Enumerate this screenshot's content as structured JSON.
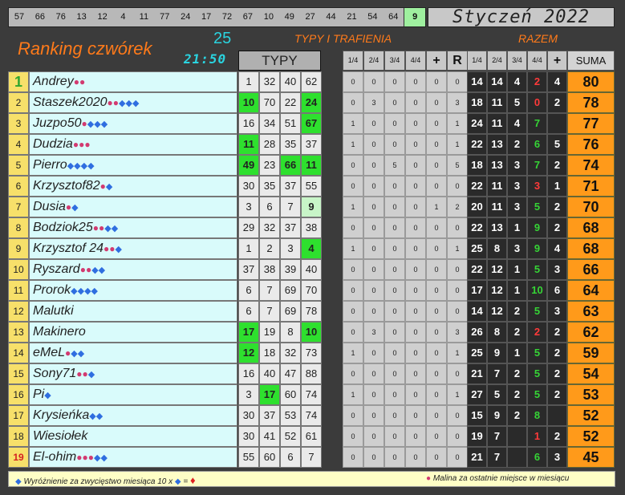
{
  "top_numbers": [
    "57",
    "66",
    "76",
    "13",
    "12",
    "4",
    "11",
    "77",
    "24",
    "17",
    "72",
    "67",
    "10",
    "49",
    "27",
    "44",
    "21",
    "54",
    "64",
    "9"
  ],
  "month": "Styczeń 2022",
  "title": "Ranking czwórek",
  "count": "25",
  "time": "21:50",
  "header_typy_trafienia": "TYPY I TRAFIENIA",
  "header_razem": "RAZEM",
  "typy_label": "TYPY",
  "sub_headers": [
    "1/4",
    "2/4",
    "3/4",
    "4/4",
    "+",
    "R"
  ],
  "razem_headers": [
    "1/4",
    "2/4",
    "3/4",
    "4/4",
    "+"
  ],
  "suma_label": "SUMA",
  "rows": [
    {
      "rank": "1",
      "name": "Andrey",
      "gems": 0,
      "rasp": 2,
      "typy": [
        "1",
        "32",
        "40",
        "62"
      ],
      "hits": [
        0,
        0,
        0,
        0
      ],
      "stats": [
        "0",
        "0",
        "0",
        "0",
        "0",
        "0"
      ],
      "razem": [
        "14",
        "14",
        "4",
        "2",
        "4"
      ],
      "suma": "80",
      "r3": "red"
    },
    {
      "rank": "2",
      "name": "Staszek2020",
      "gems": 3,
      "rasp": 2,
      "typy": [
        "10",
        "70",
        "22",
        "24"
      ],
      "hits": [
        1,
        0,
        0,
        1
      ],
      "stats": [
        "0",
        "3",
        "0",
        "0",
        "0",
        "3"
      ],
      "razem": [
        "18",
        "11",
        "5",
        "0",
        "2"
      ],
      "suma": "78",
      "r3": "red"
    },
    {
      "rank": "3",
      "name": "Juzpo50",
      "gems": 3,
      "rasp": 1,
      "typy": [
        "16",
        "34",
        "51",
        "67"
      ],
      "hits": [
        0,
        0,
        0,
        1
      ],
      "stats": [
        "1",
        "0",
        "0",
        "0",
        "0",
        "1"
      ],
      "razem": [
        "24",
        "11",
        "4",
        "7",
        ""
      ],
      "suma": "77",
      "r3": "green"
    },
    {
      "rank": "4",
      "name": "Dudzia",
      "gems": 0,
      "rasp": 3,
      "typy": [
        "11",
        "28",
        "35",
        "37"
      ],
      "hits": [
        1,
        0,
        0,
        0
      ],
      "stats": [
        "1",
        "0",
        "0",
        "0",
        "0",
        "1"
      ],
      "razem": [
        "22",
        "13",
        "2",
        "6",
        "5"
      ],
      "suma": "76",
      "r3": "green"
    },
    {
      "rank": "5",
      "name": "Pierro",
      "gems": 4,
      "rasp": 0,
      "typy": [
        "49",
        "23",
        "66",
        "11"
      ],
      "hits": [
        1,
        0,
        1,
        1
      ],
      "stats": [
        "0",
        "0",
        "5",
        "0",
        "0",
        "5"
      ],
      "razem": [
        "18",
        "13",
        "3",
        "7",
        "2"
      ],
      "suma": "74",
      "r3": "green"
    },
    {
      "rank": "6",
      "name": "Krzysztof82",
      "gems": 1,
      "rasp": 1,
      "typy": [
        "30",
        "35",
        "37",
        "55"
      ],
      "hits": [
        0,
        0,
        0,
        0
      ],
      "stats": [
        "0",
        "0",
        "0",
        "0",
        "0",
        "0"
      ],
      "razem": [
        "22",
        "11",
        "3",
        "3",
        "1"
      ],
      "suma": "71",
      "r3": "red"
    },
    {
      "rank": "7",
      "name": "Dusia",
      "gems": 1,
      "rasp": 1,
      "typy": [
        "3",
        "6",
        "7",
        "9"
      ],
      "hits": [
        0,
        0,
        0,
        2
      ],
      "stats": [
        "1",
        "0",
        "0",
        "0",
        "1",
        "2"
      ],
      "razem": [
        "20",
        "11",
        "3",
        "5",
        "2"
      ],
      "suma": "70",
      "r3": "green"
    },
    {
      "rank": "8",
      "name": "Bodziok25",
      "gems": 2,
      "rasp": 2,
      "typy": [
        "29",
        "32",
        "37",
        "38"
      ],
      "hits": [
        0,
        0,
        0,
        0
      ],
      "stats": [
        "0",
        "0",
        "0",
        "0",
        "0",
        "0"
      ],
      "razem": [
        "22",
        "13",
        "1",
        "9",
        "2"
      ],
      "suma": "68",
      "r3": "green"
    },
    {
      "rank": "9",
      "name": "Krzysztof 24",
      "gems": 1,
      "rasp": 2,
      "typy": [
        "1",
        "2",
        "3",
        "4"
      ],
      "hits": [
        0,
        0,
        0,
        1
      ],
      "stats": [
        "1",
        "0",
        "0",
        "0",
        "0",
        "1"
      ],
      "razem": [
        "25",
        "8",
        "3",
        "9",
        "4"
      ],
      "suma": "68",
      "r3": "green"
    },
    {
      "rank": "10",
      "name": "Ryszard",
      "gems": 2,
      "rasp": 2,
      "typy": [
        "37",
        "38",
        "39",
        "40"
      ],
      "hits": [
        0,
        0,
        0,
        0
      ],
      "stats": [
        "0",
        "0",
        "0",
        "0",
        "0",
        "0"
      ],
      "razem": [
        "22",
        "12",
        "1",
        "5",
        "3"
      ],
      "suma": "66",
      "r3": "green"
    },
    {
      "rank": "11",
      "name": "Prorok",
      "gems": 4,
      "rasp": 0,
      "typy": [
        "6",
        "7",
        "69",
        "70"
      ],
      "hits": [
        0,
        0,
        0,
        0
      ],
      "stats": [
        "0",
        "0",
        "0",
        "0",
        "0",
        "0"
      ],
      "razem": [
        "17",
        "12",
        "1",
        "10",
        "6"
      ],
      "suma": "64",
      "r3": "green"
    },
    {
      "rank": "12",
      "name": "Malutki",
      "gems": 0,
      "rasp": 0,
      "typy": [
        "6",
        "7",
        "69",
        "78"
      ],
      "hits": [
        0,
        0,
        0,
        0
      ],
      "stats": [
        "0",
        "0",
        "0",
        "0",
        "0",
        "0"
      ],
      "razem": [
        "14",
        "12",
        "2",
        "5",
        "3"
      ],
      "suma": "63",
      "r3": "green"
    },
    {
      "rank": "13",
      "name": "Makinero",
      "gems": 0,
      "rasp": 0,
      "typy": [
        "17",
        "19",
        "8",
        "10"
      ],
      "hits": [
        1,
        0,
        0,
        1
      ],
      "stats": [
        "0",
        "3",
        "0",
        "0",
        "0",
        "3"
      ],
      "razem": [
        "26",
        "8",
        "2",
        "2",
        "2"
      ],
      "suma": "62",
      "r3": "red"
    },
    {
      "rank": "14",
      "name": "eMeL",
      "gems": 2,
      "rasp": 1,
      "typy": [
        "12",
        "18",
        "32",
        "73"
      ],
      "hits": [
        1,
        0,
        0,
        0
      ],
      "stats": [
        "1",
        "0",
        "0",
        "0",
        "0",
        "1"
      ],
      "razem": [
        "25",
        "9",
        "1",
        "5",
        "2"
      ],
      "suma": "59",
      "r3": "green"
    },
    {
      "rank": "15",
      "name": "Sony71",
      "gems": 1,
      "rasp": 2,
      "typy": [
        "16",
        "40",
        "47",
        "88"
      ],
      "hits": [
        0,
        0,
        0,
        0
      ],
      "stats": [
        "0",
        "0",
        "0",
        "0",
        "0",
        "0"
      ],
      "razem": [
        "21",
        "7",
        "2",
        "5",
        "2"
      ],
      "suma": "54",
      "r3": "green"
    },
    {
      "rank": "16",
      "name": "Pi",
      "gems": 1,
      "rasp": 0,
      "typy": [
        "3",
        "17",
        "60",
        "74"
      ],
      "hits": [
        0,
        1,
        0,
        0
      ],
      "stats": [
        "1",
        "0",
        "0",
        "0",
        "0",
        "1"
      ],
      "razem": [
        "27",
        "5",
        "2",
        "5",
        "2"
      ],
      "suma": "53",
      "r3": "green"
    },
    {
      "rank": "17",
      "name": "Krysieńka",
      "gems": 2,
      "rasp": 0,
      "typy": [
        "30",
        "37",
        "53",
        "74"
      ],
      "hits": [
        0,
        0,
        0,
        0
      ],
      "stats": [
        "0",
        "0",
        "0",
        "0",
        "0",
        "0"
      ],
      "razem": [
        "15",
        "9",
        "2",
        "8",
        ""
      ],
      "suma": "52",
      "r3": "green"
    },
    {
      "rank": "18",
      "name": "Wiesiołek",
      "gems": 0,
      "rasp": 0,
      "typy": [
        "30",
        "41",
        "52",
        "61"
      ],
      "hits": [
        0,
        0,
        0,
        0
      ],
      "stats": [
        "0",
        "0",
        "0",
        "0",
        "0",
        "0"
      ],
      "razem": [
        "19",
        "7",
        "",
        "1",
        "2"
      ],
      "suma": "52",
      "r3": "red"
    },
    {
      "rank": "19",
      "name": "El-ohim",
      "gems": 2,
      "rasp": 3,
      "typy": [
        "55",
        "60",
        "6",
        "7"
      ],
      "hits": [
        0,
        0,
        0,
        0
      ],
      "stats": [
        "0",
        "0",
        "0",
        "0",
        "0",
        "0"
      ],
      "razem": [
        "21",
        "7",
        "",
        "6",
        "3"
      ],
      "suma": "45",
      "r3": "green"
    }
  ],
  "legend_left": "Wyróżnienie za zwycięstwo miesiąca 10 x",
  "legend_eq": "=",
  "legend_right": "Malina za ostatnie miejsce w miesiącu",
  "colors": {
    "hit": "#2ee02e",
    "suma": "#ff9a1a",
    "name_bg": "#d9fbfb",
    "rank_bg": "#f7e06a",
    "title": "#ff7a1a",
    "accent": "#2ad4e0"
  }
}
